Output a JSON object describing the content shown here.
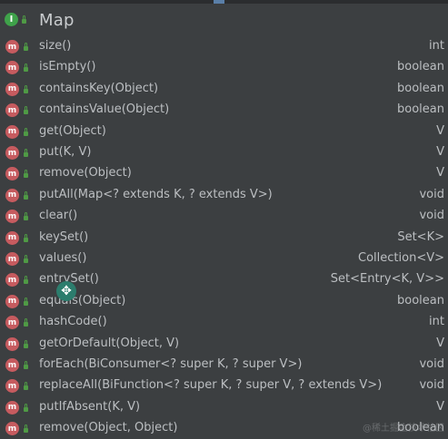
{
  "interface": {
    "name": "Map",
    "icon": "interface-icon",
    "badge_letter": "I"
  },
  "method_badge_letter": "m",
  "methods": [
    {
      "name": "size()",
      "type": "int"
    },
    {
      "name": "isEmpty()",
      "type": "boolean"
    },
    {
      "name": "containsKey(Object)",
      "type": "boolean"
    },
    {
      "name": "containsValue(Object)",
      "type": "boolean"
    },
    {
      "name": "get(Object)",
      "type": "V"
    },
    {
      "name": "put(K, V)",
      "type": "V"
    },
    {
      "name": "remove(Object)",
      "type": "V"
    },
    {
      "name": "putAll(Map<? extends K, ? extends V>)",
      "type": "void"
    },
    {
      "name": "clear()",
      "type": "void"
    },
    {
      "name": "keySet()",
      "type": "Set<K>"
    },
    {
      "name": "values()",
      "type": "Collection<V>"
    },
    {
      "name": "entrySet()",
      "type": "Set<Entry<K, V>>"
    },
    {
      "name": "equals(Object)",
      "type": "boolean"
    },
    {
      "name": "hashCode()",
      "type": "int"
    },
    {
      "name": "getOrDefault(Object, V)",
      "type": "V"
    },
    {
      "name": "forEach(BiConsumer<? super K, ? super V>)",
      "type": "void"
    },
    {
      "name": "replaceAll(BiFunction<? super K, ? super V, ? extends V>)",
      "type": "void"
    },
    {
      "name": "putIfAbsent(K, V)",
      "type": "V"
    },
    {
      "name": "remove(Object, Object)",
      "type": "boolean"
    }
  ],
  "cursor_icon": "move-cursor-icon",
  "watermark": "@稀土掘金技术社区",
  "colors": {
    "background": "#3c3f41",
    "text": "#bcbfc2",
    "interface_badge": "#3fa24a",
    "method_badge": "#c65b5f",
    "access_lock": "#4f9a45"
  }
}
